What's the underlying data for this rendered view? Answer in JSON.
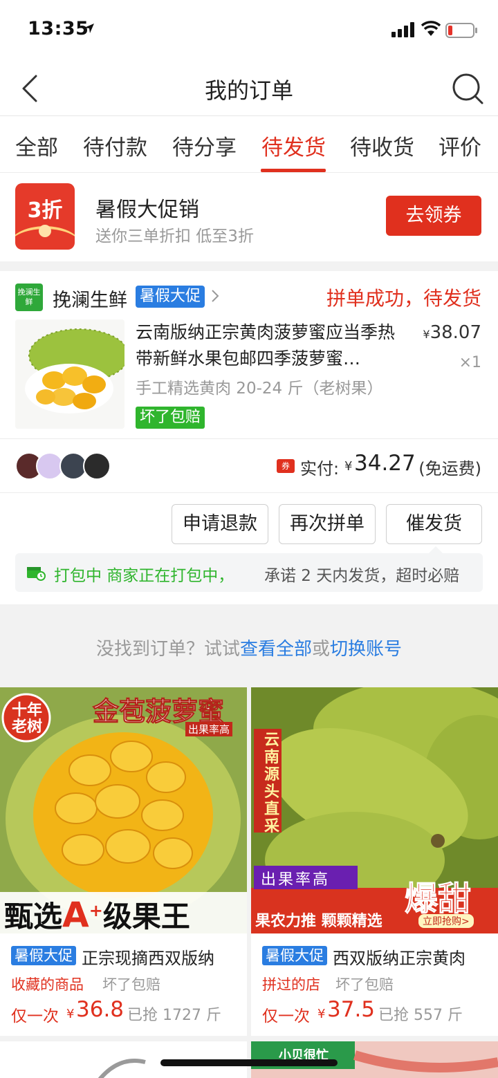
{
  "status_bar": {
    "time": "13:35"
  },
  "nav": {
    "title": "我的订单"
  },
  "tabs": [
    {
      "label": "全部"
    },
    {
      "label": "待付款"
    },
    {
      "label": "待分享"
    },
    {
      "label": "待发货"
    },
    {
      "label": "待收货"
    },
    {
      "label": "评价"
    }
  ],
  "active_tab": "待发货",
  "promo": {
    "badge": "3折",
    "title": "暑假大促销",
    "subtitle": "送你三单折扣 低至3折",
    "button": "去领券"
  },
  "order": {
    "shop_logo": "挽澜生鲜",
    "shop_name": "挽澜生鲜",
    "shop_tag": "暑假大促",
    "status": "拼单成功，待发货",
    "product_title": "云南版纳正宗黄肉菠萝蜜应当季热带新鲜水果包邮四季菠萝蜜…",
    "price_symbol": "¥",
    "price": "38.07",
    "quantity": "×1",
    "spec": "手工精选黄肉 20-24 斤（老树果）",
    "guarantee": "坏了包赔",
    "coupon_icon": "券",
    "paid_label": "实付:",
    "paid_symbol": "¥",
    "paid_amount": "34.27",
    "shipping_note": "(免运费)",
    "buttons": {
      "refund": "申请退款",
      "regroup": "再次拼单",
      "urge": "催发货"
    },
    "notice_state": "打包中 商家正在打包中，",
    "notice_text": "承诺 2 天内发货，超时必赔"
  },
  "hint": {
    "prefix": "没找到订单？试试",
    "link_all": "查看全部",
    "middle": "或",
    "link_switch": "切换账号"
  },
  "recommendations": [
    {
      "image_text_top": "金苞菠萝蜜",
      "image_text_sub": "出果率高",
      "image_corner": "十年老树",
      "image_text_bottom_1": "甄选",
      "image_text_bottom_2": "A",
      "image_text_bottom_3": "级果王",
      "tag": "暑假大促",
      "title": "正宗现摘西双版纳",
      "meta1": "收藏的商品",
      "meta2": "坏了包赔",
      "once": "仅一次",
      "symbol": "¥",
      "price": "36.8",
      "sold": "已抢 1727 斤"
    },
    {
      "image_side": "云南源头直采",
      "image_ribbon": "出果率高",
      "image_big": "爆甜",
      "image_bottom": "果农力推 颗颗精选",
      "image_cta": "立即抢购>",
      "tag": "暑假大促",
      "title": "西双版纳正宗黄肉",
      "meta1": "拼过的店",
      "meta2": "坏了包赔",
      "once": "仅一次",
      "symbol": "¥",
      "price": "37.5",
      "sold": "已抢 557 斤"
    }
  ],
  "bottom_peek_label": "小贝很忙",
  "colors": {
    "accent_red": "#e0301e",
    "blue": "#2a7de1",
    "green": "#2fb52d"
  }
}
